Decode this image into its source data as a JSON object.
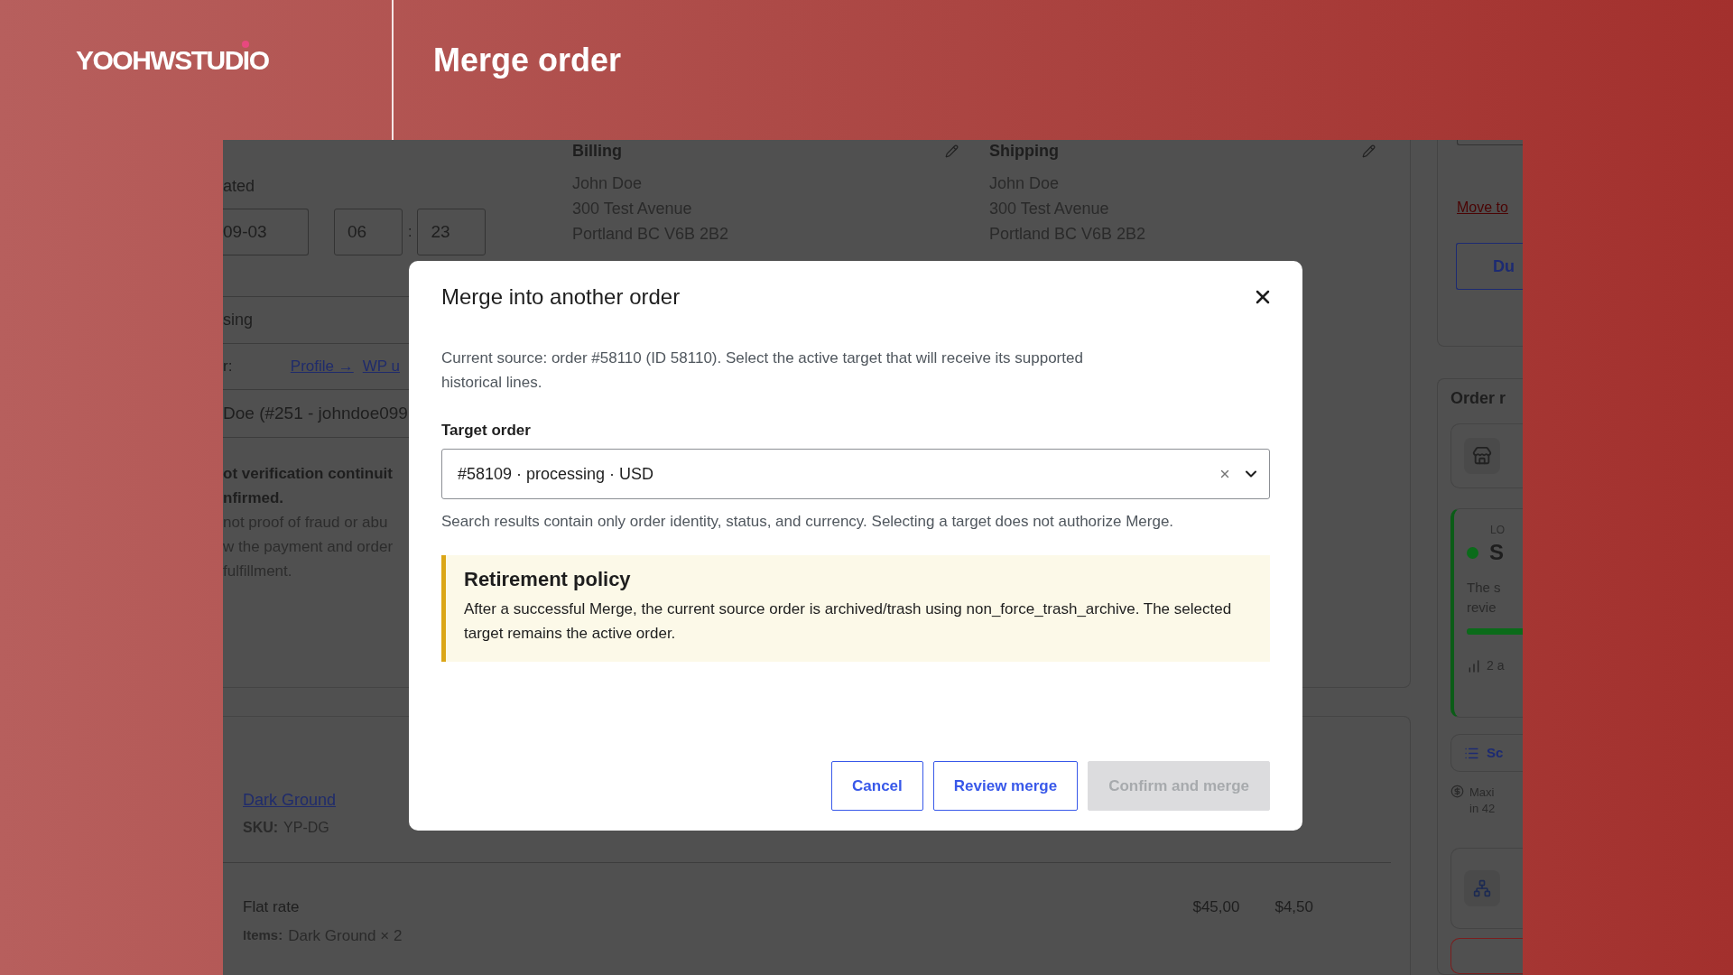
{
  "brand": {
    "logo": "YOOHWSTUDIO",
    "title": "Merge order"
  },
  "background_page": {
    "order_data": {
      "date_label": "ated",
      "date": "09-03",
      "hour": "06",
      "separator": ":",
      "minute": "23",
      "status": "sing",
      "customer_label": "r:",
      "links": [
        "Profile →",
        "WP u"
      ],
      "customer": "Doe (#251 - johndoe099",
      "notice_lines": [
        {
          "text": "ot verification continuit",
          "bold": true
        },
        {
          "text": "nfirmed.",
          "bold": true
        },
        {
          "text": "not proof of fraud or abu",
          "bold": false
        },
        {
          "text": "w the payment and order",
          "bold": false
        },
        {
          "text": "fulfillment.",
          "bold": false
        }
      ]
    },
    "billing": {
      "title": "Billing",
      "lines": [
        "John Doe",
        "300 Test Avenue",
        "Portland BC V6B 2B2"
      ]
    },
    "shipping": {
      "title": "Shipping",
      "lines": [
        "John Doe",
        "300 Test Avenue",
        "Portland BC V6B 2B2"
      ]
    },
    "side": {
      "link": "Move to",
      "button": "Du",
      "section_title": "Order r",
      "status_card": {
        "eyebrow": "LO",
        "title": "S",
        "lines": [
          "The s",
          "revie"
        ],
        "stat": "2 a",
        "level": 1
      },
      "schedule_link": "Sc",
      "note_lines": [
        "Maxi",
        "in 42"
      ]
    },
    "item": {
      "name": "Dark Ground",
      "sku_label": "SKU:",
      "sku": "YP-DG"
    },
    "shipping_line": {
      "name": "Flat rate",
      "cost": "$45,00",
      "tax": "$4,50",
      "items_label": "Items:",
      "items": "Dark Ground × 2"
    }
  },
  "dialog": {
    "title": "Merge into another order",
    "description": "Current source: order #58110 (ID 58110). Select the active target that will receive its supported historical lines.",
    "field_label": "Target order",
    "field_value": "#58109 · processing · USD",
    "help": "Search results contain only order identity, status, and currency. Selecting a target does not authorize Merge.",
    "notice": {
      "title": "Retirement policy",
      "text": "After a successful Merge, the current source order is archived/trash using non_force_trash_archive. The selected target remains the active order."
    },
    "buttons": [
      {
        "label": "Cancel",
        "kind": "outline",
        "disabled": false
      },
      {
        "label": "Review merge",
        "kind": "outline",
        "disabled": false
      },
      {
        "label": "Confirm and merge",
        "kind": "primary",
        "disabled": true
      }
    ]
  }
}
